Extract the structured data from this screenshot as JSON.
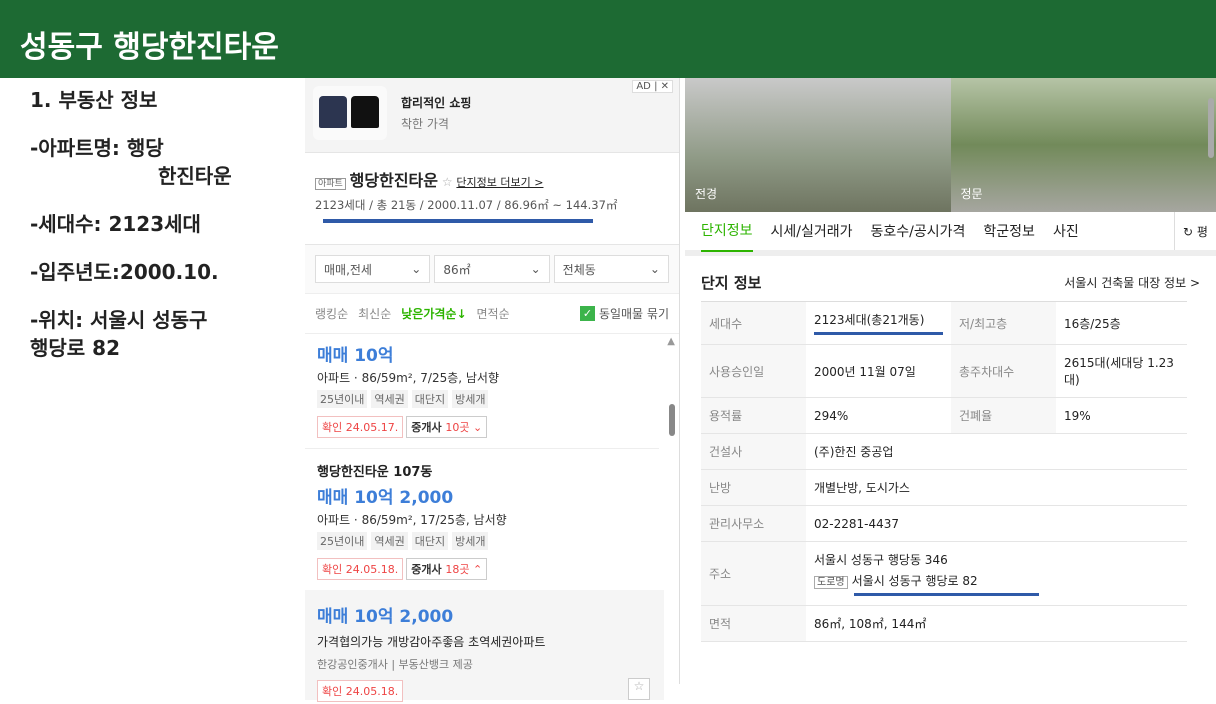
{
  "header": {
    "title": "성동구 행당한진타운"
  },
  "notes": [
    "1. 부동산 정보",
    "-아파트명: 행당",
    "한진타운",
    "-세대수: 2123세대",
    "-입주년도:2000.10.",
    "-위치: 서울시 성동구",
    "행당로 82"
  ],
  "ad": {
    "badge": "AD | ✕",
    "title": "합리적인 쇼핑",
    "subtitle": "착한 가격"
  },
  "complex": {
    "tag": "아파트",
    "name": "행당한진타운",
    "more": "단지정보 더보기 >",
    "summary": "2123세대 / 총 21동 / 2000.11.07 / 86.96㎡ ~ 144.37㎡"
  },
  "filters": [
    "매매,전세",
    "86㎡",
    "전체동"
  ],
  "sorts": [
    "랭킹순",
    "최신순",
    "낮은가격순↓",
    "면적순"
  ],
  "same_listing": "동일매물 묶기",
  "listings": [
    {
      "title": "",
      "price": "매매 10억",
      "spec": "아파트 · 86/59m², 7/25층, 남서향",
      "keywords": [
        "25년이내",
        "역세권",
        "대단지",
        "방세개"
      ],
      "confirm": "확인 24.05.17.",
      "brokers": "중개사 ",
      "brokers_count": "10곳 ⌄"
    },
    {
      "title": "행당한진타운 107동",
      "price": "매매 10억 2,000",
      "spec": "아파트 · 86/59m², 17/25층, 남서향",
      "keywords": [
        "25년이내",
        "역세권",
        "대단지",
        "방세개"
      ],
      "confirm": "확인 24.05.18.",
      "brokers": "중개사 ",
      "brokers_count": "18곳 ⌃"
    }
  ],
  "sub_listing": {
    "price": "매매 10억 2,000",
    "desc": "가격협의가능 개방감아주좋음 초역세권아파트",
    "source": "한강공인중개사 | 부동산뱅크 제공",
    "confirm": "확인 24.05.18."
  },
  "photos": [
    "전경",
    "정문"
  ],
  "tabs": [
    "단지정보",
    "시세/실거래가",
    "동호수/공시가격",
    "학군정보",
    "사진"
  ],
  "tab_extra": "↻ 평",
  "info": {
    "heading": "단지 정보",
    "link": "서울시 건축물 대장 정보 >",
    "rows": [
      [
        "세대수",
        "2123세대(총21개동)",
        "저/최고층",
        "16층/25층"
      ],
      [
        "사용승인일",
        "2000년 11월 07일",
        "총주차대수",
        "2615대(세대당 1.23대)"
      ],
      [
        "용적률",
        "294%",
        "건폐율",
        "19%"
      ],
      [
        "건설사",
        "(주)한진 중공업"
      ],
      [
        "난방",
        "개별난방, 도시가스"
      ],
      [
        "관리사무소",
        "02-2281-4437"
      ],
      [
        "주소",
        "서울시 성동구 행당동 346"
      ],
      [
        "면적",
        "86㎡, 108㎡, 144㎡"
      ]
    ],
    "road_tag": "도로명",
    "road_addr": "서울시 성동구 행당로 82"
  }
}
